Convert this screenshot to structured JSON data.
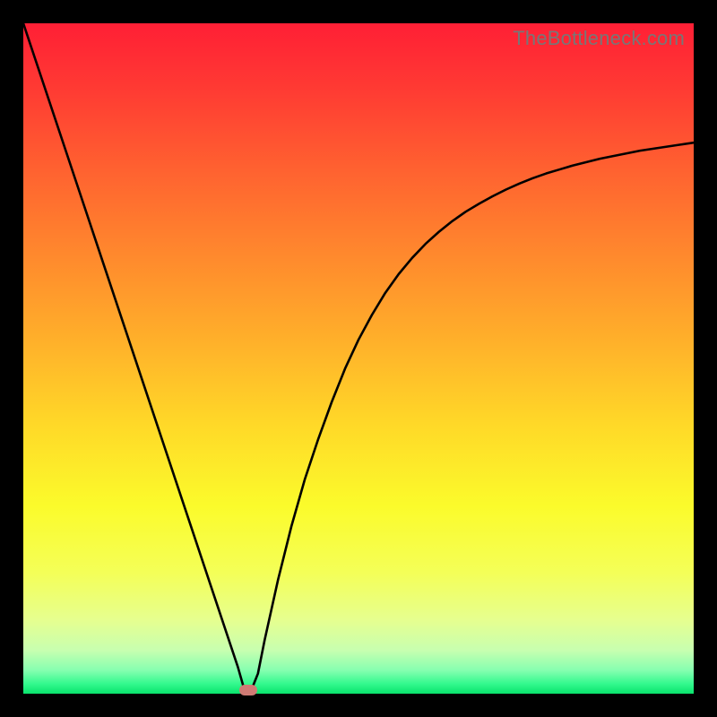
{
  "watermark": "TheBottleneck.com",
  "chart_data": {
    "type": "line",
    "title": "",
    "xlabel": "",
    "ylabel": "",
    "xlim": [
      0,
      100
    ],
    "ylim": [
      0,
      100
    ],
    "x": [
      0,
      2,
      4,
      6,
      8,
      10,
      12,
      14,
      16,
      18,
      20,
      22,
      24,
      26,
      28,
      30,
      32,
      33,
      34,
      35,
      36,
      38,
      40,
      42,
      44,
      46,
      48,
      50,
      52,
      54,
      56,
      58,
      60,
      62,
      64,
      66,
      68,
      70,
      72,
      74,
      76,
      78,
      80,
      82,
      84,
      86,
      88,
      90,
      92,
      94,
      96,
      98,
      100
    ],
    "values": [
      100,
      94,
      88,
      82,
      76,
      70,
      64,
      58,
      52,
      46,
      40,
      34,
      28,
      22,
      16,
      10,
      4,
      0.5,
      0.5,
      3,
      8,
      17,
      25,
      32,
      38,
      43.5,
      48.5,
      52.8,
      56.5,
      59.8,
      62.6,
      65,
      67.1,
      68.9,
      70.5,
      71.9,
      73.1,
      74.2,
      75.2,
      76.1,
      76.9,
      77.6,
      78.2,
      78.8,
      79.3,
      79.8,
      80.2,
      80.6,
      81,
      81.3,
      81.6,
      81.9,
      82.2
    ],
    "marker": {
      "x": 33.5,
      "y": 0.5
    },
    "gradient_stops": [
      {
        "offset": 0.0,
        "color": "#ff1f35"
      },
      {
        "offset": 0.1,
        "color": "#ff3b33"
      },
      {
        "offset": 0.22,
        "color": "#ff6230"
      },
      {
        "offset": 0.35,
        "color": "#ff8a2d"
      },
      {
        "offset": 0.48,
        "color": "#ffb22a"
      },
      {
        "offset": 0.6,
        "color": "#ffd928"
      },
      {
        "offset": 0.72,
        "color": "#fbfb2b"
      },
      {
        "offset": 0.82,
        "color": "#f4ff58"
      },
      {
        "offset": 0.89,
        "color": "#e6ff8f"
      },
      {
        "offset": 0.935,
        "color": "#c8ffb0"
      },
      {
        "offset": 0.965,
        "color": "#86ffb0"
      },
      {
        "offset": 0.985,
        "color": "#34f98e"
      },
      {
        "offset": 1.0,
        "color": "#09e36c"
      }
    ]
  }
}
